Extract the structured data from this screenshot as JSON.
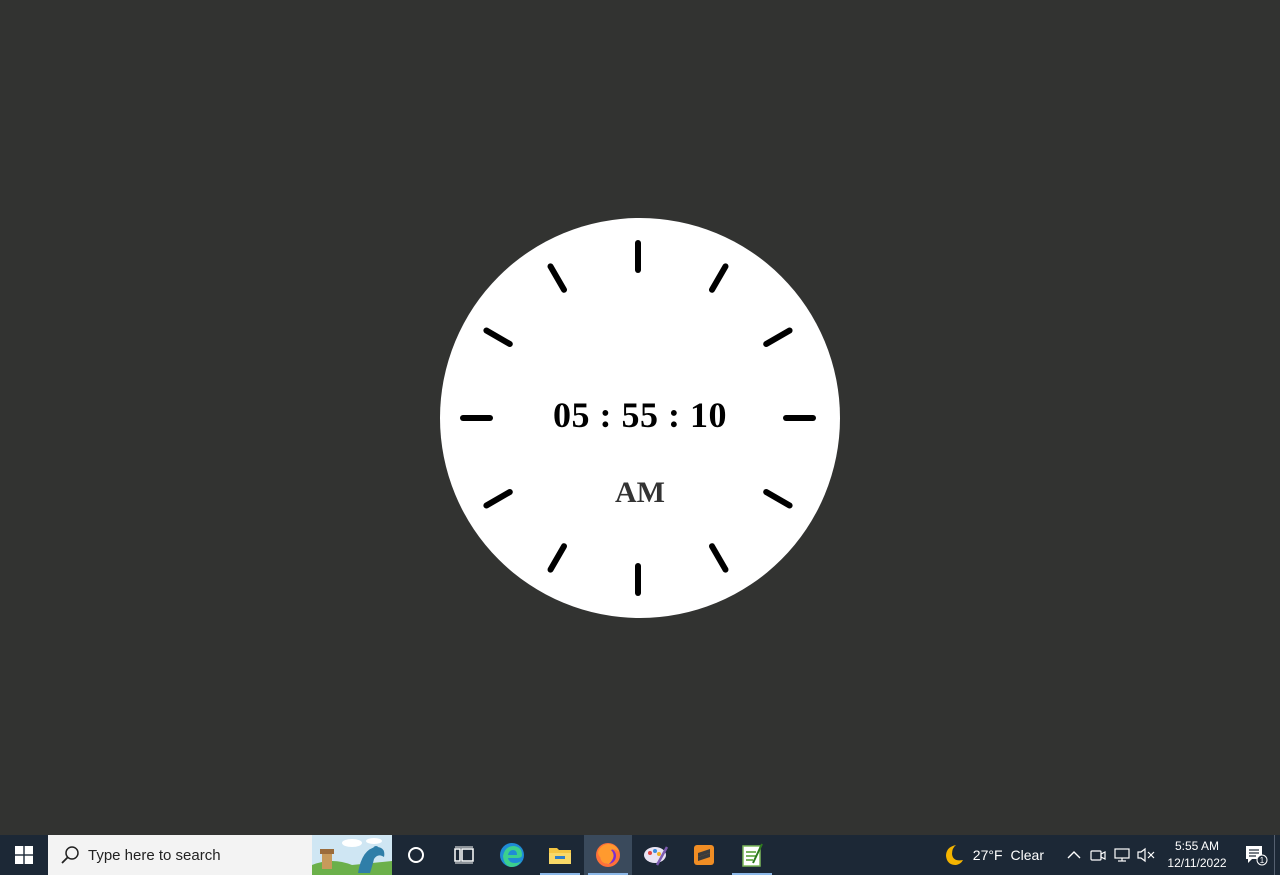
{
  "clock": {
    "time": "05 : 55 : 10",
    "meridiem": "AM",
    "face_color": "#ffffff",
    "tick_color": "#000000",
    "tick_count": 12
  },
  "desktop": {
    "background_color": "#323331"
  },
  "taskbar": {
    "search_placeholder": "Type here to search",
    "apps": [
      {
        "name": "cortana-icon",
        "running": false,
        "active": false
      },
      {
        "name": "task-view-icon",
        "running": false,
        "active": false
      },
      {
        "name": "edge-icon",
        "running": false,
        "active": false
      },
      {
        "name": "file-explorer-icon",
        "running": true,
        "active": false
      },
      {
        "name": "firefox-icon",
        "running": true,
        "active": true
      },
      {
        "name": "paint-icon",
        "running": false,
        "active": false
      },
      {
        "name": "sublime-text-icon",
        "running": false,
        "active": false
      },
      {
        "name": "notepad-plus-icon",
        "running": true,
        "active": false
      }
    ],
    "weather": {
      "temperature": "27°F",
      "condition": "Clear",
      "icon": "moon-icon"
    },
    "clock_time": "5:55 AM",
    "clock_date": "12/11/2022",
    "notification_count": "1"
  }
}
